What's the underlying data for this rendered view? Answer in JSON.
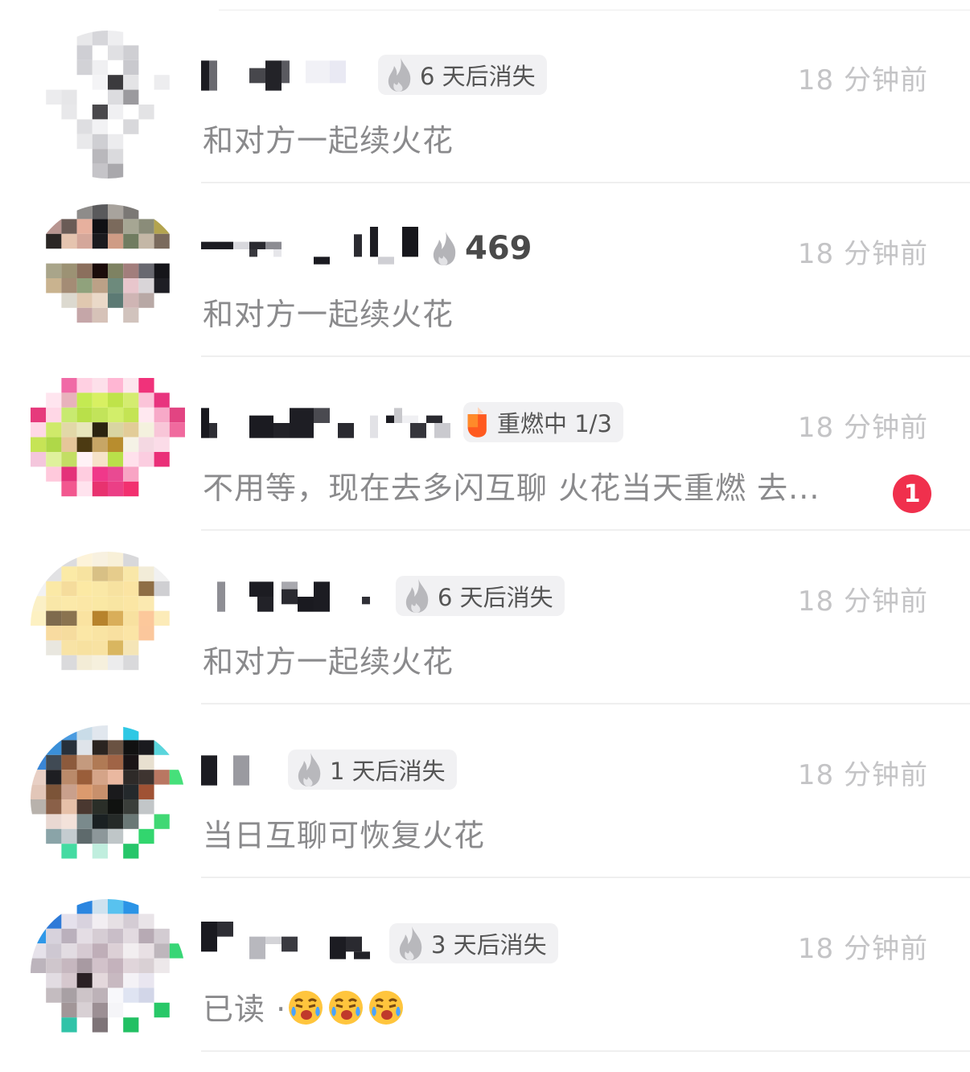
{
  "chats": [
    {
      "badge": {
        "type": "expiring",
        "text": "6 天后消失"
      },
      "time": "18 分钟前",
      "message": "和对方一起续火花",
      "unread": null
    },
    {
      "badge": {
        "type": "streak",
        "text": "469"
      },
      "time": "18 分钟前",
      "message": "和对方一起续火花",
      "unread": null
    },
    {
      "badge": {
        "type": "reignite",
        "text": "重燃中 1/3"
      },
      "time": "18 分钟前",
      "message": "不用等，现在去多闪互聊 火花当天重燃 去...",
      "unread": "1"
    },
    {
      "badge": {
        "type": "expiring",
        "text": "6 天后消失"
      },
      "time": "18 分钟前",
      "message": "和对方一起续火花",
      "unread": null
    },
    {
      "badge": {
        "type": "expiring",
        "text": "1 天后消失"
      },
      "time": "18 分钟前",
      "message": "当日互聊可恢复火花",
      "unread": null
    },
    {
      "badge": {
        "type": "expiring",
        "text": "3 天后消失"
      },
      "time": "18 分钟前",
      "message": "已读 · ",
      "emojis": [
        "cry-emoji",
        "cry-emoji",
        "cry-emoji"
      ],
      "unread": null
    }
  ],
  "colors": {
    "time": "#c4c4c6",
    "message": "#8a8a8c",
    "badge_bg": "#f1f1f3",
    "unread": "#f0304d",
    "reignite_flame": "#ff5a1f"
  }
}
